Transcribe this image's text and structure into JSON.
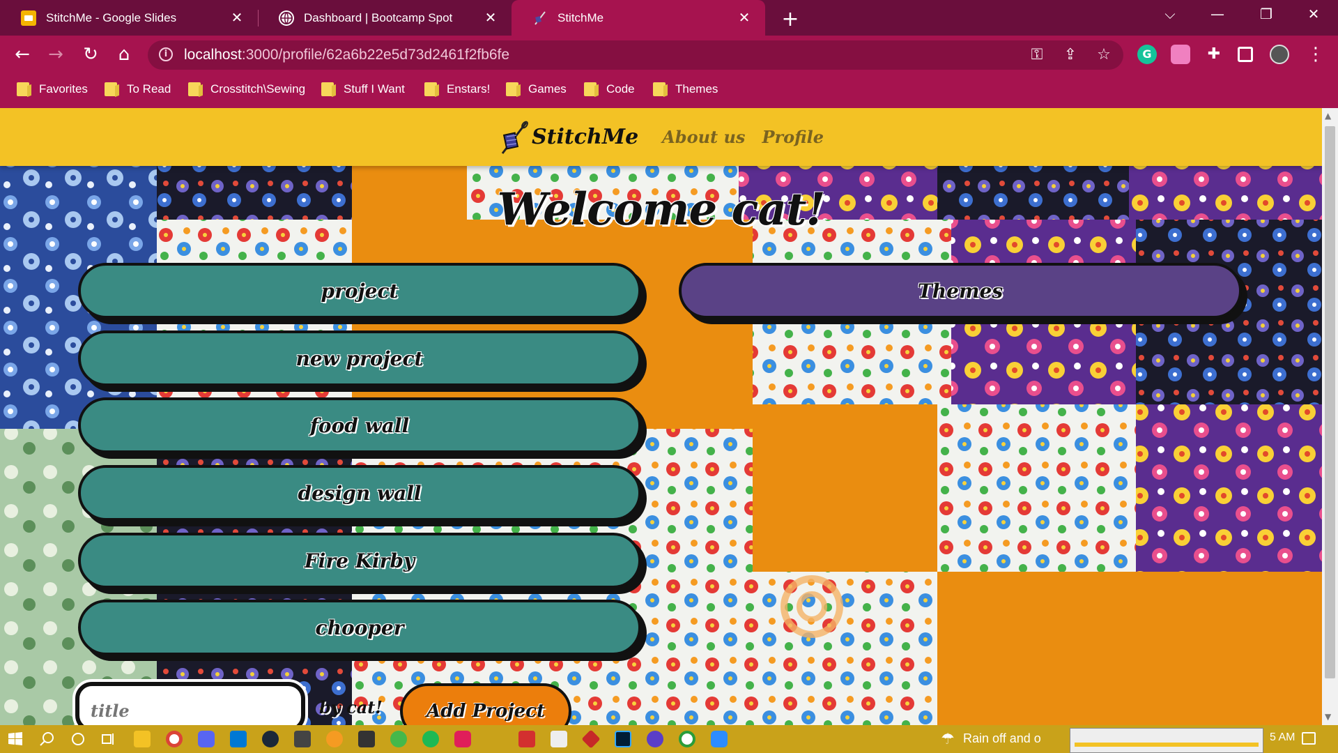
{
  "browser": {
    "tabs": [
      {
        "title": "StitchMe - Google Slides",
        "icon": "slides-icon"
      },
      {
        "title": "Dashboard | Bootcamp Spot",
        "icon": "globe-icon"
      },
      {
        "title": "StitchMe",
        "icon": "needle-icon",
        "active": true
      }
    ],
    "url_host": "localhost",
    "url_rest": ":3000/profile/62a6b22e5d73d2461f2fb6fe",
    "bookmarks": [
      "Favorites",
      "To Read",
      "Crosstitch\\Sewing",
      "Stuff I Want",
      "Enstars!",
      "Games",
      "Code",
      "Themes"
    ]
  },
  "site": {
    "brand": "StitchMe",
    "nav_about": "About us",
    "nav_profile": "Profile",
    "welcome": "Welcome cat!",
    "projects": [
      "project",
      "new project",
      "food wall",
      "design wall",
      "Fire Kirby",
      "chooper"
    ],
    "themes_button": "Themes",
    "title_placeholder": "title",
    "byline": "by cat!",
    "add_button": "Add Project"
  },
  "taskbar": {
    "weather": "Rain off and o",
    "time": "5 AM"
  },
  "colors": {
    "chrome": "#a6134f",
    "chrome_dark": "#6a0e3c",
    "navbar": "#f3c225",
    "teal": "#3a8b83",
    "purple": "#5a4286",
    "orange": "#ec7e0c"
  }
}
